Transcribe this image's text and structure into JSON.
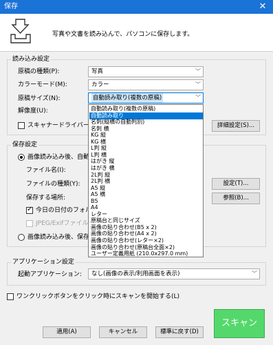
{
  "window": {
    "title": "保存",
    "close_label": "✕"
  },
  "header": {
    "text": "写真や文書を読み込んで、パソコンに保存します。"
  },
  "scan_settings": {
    "group_label": "読み込み設定",
    "doc_type": {
      "label": "原稿の種類(P):",
      "value": "写真"
    },
    "color_mode": {
      "label": "カラーモード(M):",
      "value": "カラー"
    },
    "doc_size": {
      "label": "原稿サイズ(N):",
      "value": "自動読み取り(複数の原稿)"
    },
    "resolution": {
      "label": "解像度(U):"
    },
    "driver_checkbox": {
      "label": "スキャナードライバーを使"
    },
    "detail_button": "詳細設定(S)..."
  },
  "size_options": [
    "自動読み取り(複数の原稿)",
    "自動読み取り",
    "名刺(縦横の自動判別)",
    "名刺 横",
    "KG 縦",
    "KG 横",
    "L判 縦",
    "L判 横",
    "はがき 縦",
    "はがき 横",
    "2L判 縦",
    "2L判 横",
    "A5 縦",
    "A5 横",
    "B5",
    "A4",
    "レター",
    "原稿台と同じサイズ",
    "画像の貼り合わせ(B5 x 2)",
    "画像の貼り合わせ(A4 x 2)",
    "画像の貼り合わせ(レター×2)",
    "画像の貼り合わせ(原稿台全面×2)",
    "ユーザー定義用紙 (210.0x297.0 mm)"
  ],
  "size_selected_index": 1,
  "save_settings": {
    "group_label": "保存設定",
    "radio_save": "画像読み込み後、自動",
    "filename_label": "ファイル名(I):",
    "filetype_label": "ファイルの種類(Y):",
    "location_label": "保存する場所:",
    "settings_button": "設定(T)...",
    "browse_button": "参照(B)...",
    "date_folder_checkbox": "今日の日付のフォル",
    "jpeg_checkbox": "JPEG/Exifファイルを",
    "radio_after": "画像読み込み後、保存"
  },
  "app_settings": {
    "group_label": "アプリケーション設定",
    "launch_label": "起動アプリケーション:",
    "launch_value": "なし(画像の表示/利用画面を表示)"
  },
  "oneclick_checkbox": "ワンクリックボタンをクリック時にスキャンを開始する(L)",
  "buttons": {
    "apply": "適用(A)",
    "cancel": "キャンセル",
    "default": "標準に戻す(D)",
    "scan": "スキャン"
  }
}
